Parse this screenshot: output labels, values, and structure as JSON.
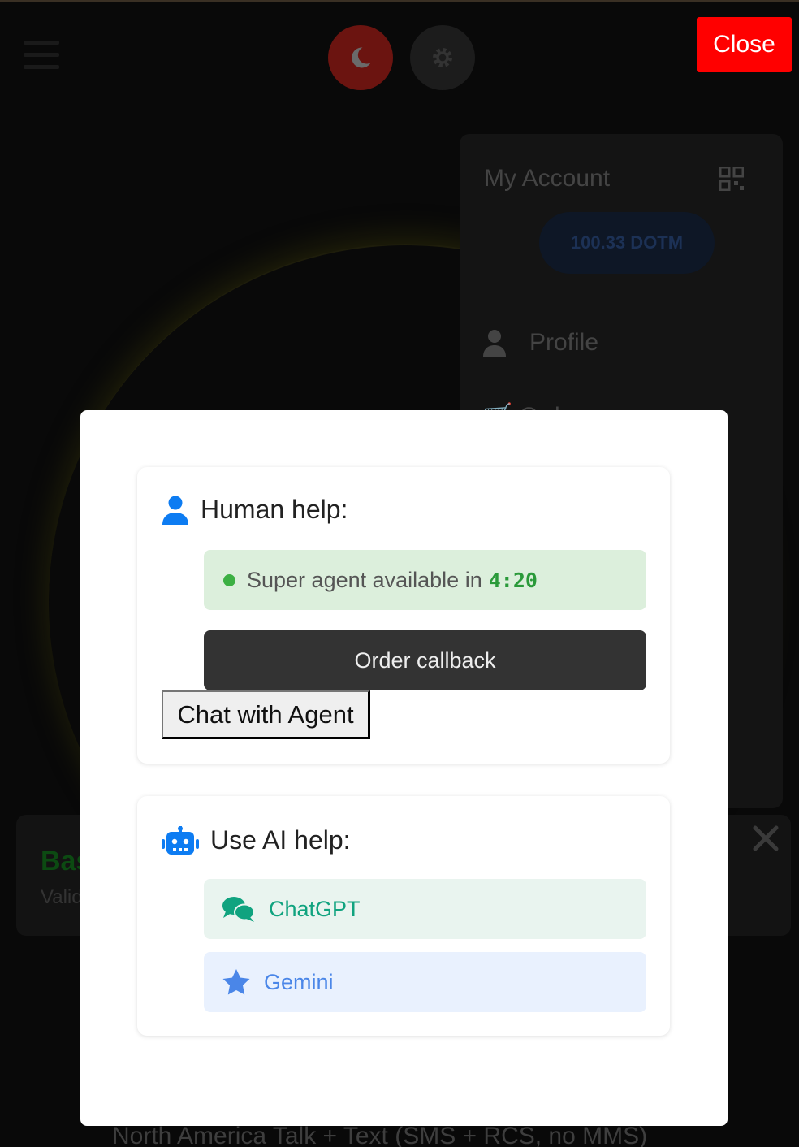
{
  "topbar": {
    "menu_icon": "hamburger-icon",
    "theme_icon": "moon-icon",
    "settings_icon": "gear-icon",
    "close_label": "Close"
  },
  "account": {
    "title": "My Account",
    "qr_icon": "qr-code-icon",
    "balance": "100.33 DOTM",
    "menu": [
      {
        "icon": "user-icon",
        "label": "Profile"
      },
      {
        "icon": "cart-icon",
        "label": "Orders"
      }
    ]
  },
  "plan_card": {
    "name": "Bas",
    "subtitle": "Valid",
    "close_icon": "close-icon"
  },
  "footer": {
    "text": "North America Talk + Text (SMS + RCS, no MMS)"
  },
  "modal": {
    "human": {
      "icon": "user-icon",
      "heading": "Human help:",
      "status_text": "Super agent available in",
      "countdown": "4:20",
      "callback_label": "Order callback",
      "chat_label": "Chat with Agent"
    },
    "ai": {
      "icon": "robot-icon",
      "heading": "Use AI help:",
      "options": [
        {
          "icon": "chat-bubbles-icon",
          "label": "ChatGPT",
          "color": "#10a37f"
        },
        {
          "icon": "star-icon",
          "label": "Gemini",
          "color": "#4a86e8"
        }
      ]
    }
  },
  "colors": {
    "close_button": "#ff0000",
    "status_green": "#3cb043",
    "human_icon_blue": "#0d7cf2"
  }
}
